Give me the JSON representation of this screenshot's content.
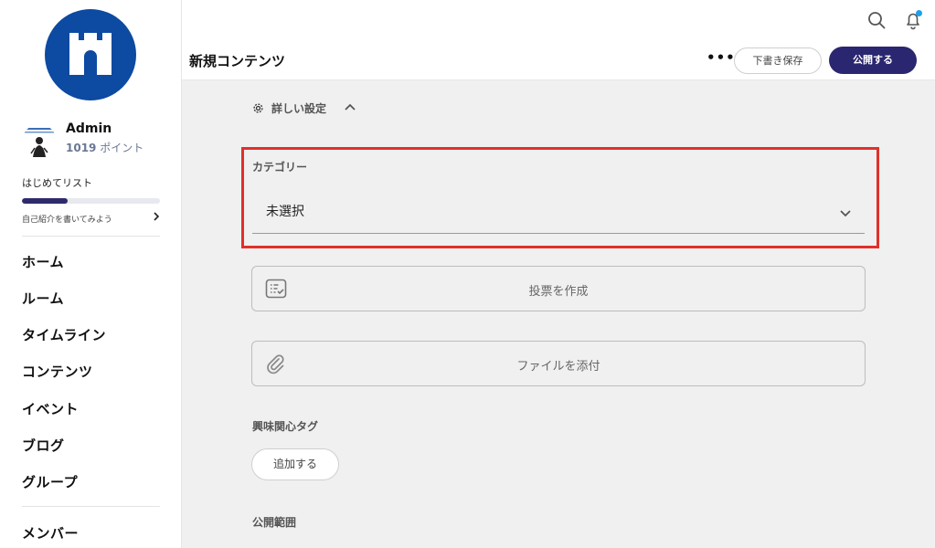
{
  "sidebar": {
    "user": {
      "name": "Admin",
      "points_value": "1019",
      "points_label": "ポイント"
    },
    "checklist": {
      "title": "はじめてリスト",
      "progress": 0.33,
      "next_item": "自己紹介を書いてみよう"
    },
    "nav": [
      {
        "label": "ホーム"
      },
      {
        "label": "ルーム"
      },
      {
        "label": "タイムライン"
      },
      {
        "label": "コンテンツ"
      },
      {
        "label": "イベント"
      },
      {
        "label": "ブログ"
      },
      {
        "label": "グループ"
      }
    ],
    "nav_secondary": [
      {
        "label": "メンバー"
      }
    ]
  },
  "header": {
    "title": "新規コンテンツ",
    "more_label": "•••",
    "draft_label": "下書き保存",
    "publish_label": "公開する",
    "has_notification": true
  },
  "form": {
    "advanced_settings_label": "詳しい設定",
    "category": {
      "label": "カテゴリー",
      "selected": "未選択"
    },
    "poll_label": "投票を作成",
    "attach_label": "ファイルを添付",
    "tags": {
      "label": "興味関心タグ",
      "add_label": "追加する"
    },
    "visibility_label": "公開範囲"
  },
  "colors": {
    "brand": "#0d4aa1",
    "primary_button": "#2a2670",
    "highlight": "#e1302a",
    "notification": "#1ea0e8"
  },
  "icons": [
    "castle-logo-icon",
    "search-icon",
    "bell-icon",
    "gear-icon",
    "chevron-up-icon",
    "chevron-down-icon",
    "poll-icon",
    "paperclip-icon",
    "chevron-right-icon"
  ]
}
